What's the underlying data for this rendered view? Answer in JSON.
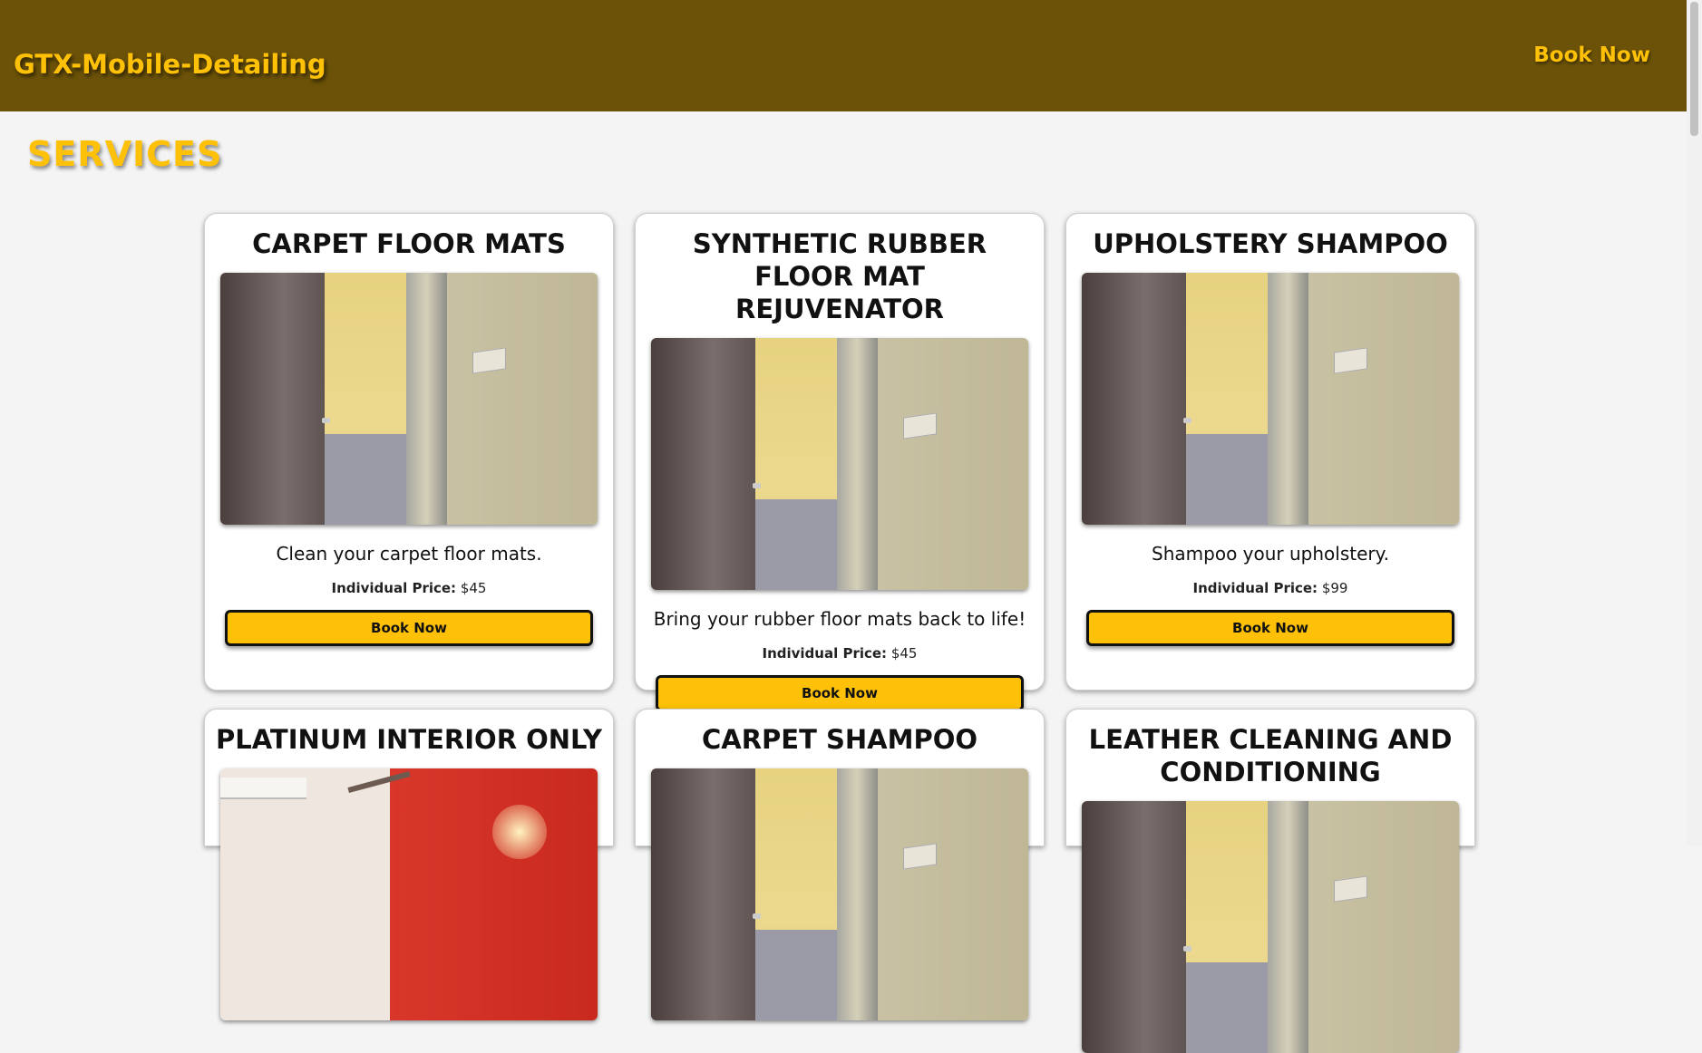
{
  "header": {
    "brand": "GTX-Mobile-Detailing",
    "nav_book": "Book Now"
  },
  "main": {
    "section_title": "SERVICES"
  },
  "services": [
    {
      "title": "CARPET FLOOR MATS",
      "image": "hallway-photo",
      "description": "Clean your carpet floor mats.",
      "price_label": "Individual Price:",
      "price_value": "$45",
      "button_label": "Book Now"
    },
    {
      "title": "SYNTHETIC RUBBER FLOOR MAT REJUVENATOR",
      "image": "hallway-photo",
      "description": "Bring your rubber floor mats back to life!",
      "price_label": "Individual Price:",
      "price_value": "$45",
      "button_label": "Book Now"
    },
    {
      "title": "UPHOLSTERY SHAMPOO",
      "image": "hallway-photo",
      "description": "Shampoo your upholstery.",
      "price_label": "Individual Price:",
      "price_value": "$99",
      "button_label": "Book Now"
    },
    {
      "title": "PLATINUM INTERIOR ONLY",
      "image": "red-room-photo"
    },
    {
      "title": "CARPET SHAMPOO",
      "image": "hallway-photo"
    },
    {
      "title": "LEATHER CLEANING AND CONDITIONING",
      "image": "hallway-photo"
    }
  ],
  "colors": {
    "header_bg": "#6b5208",
    "accent": "#ffc107",
    "page_bg": "#f4f4f4"
  }
}
